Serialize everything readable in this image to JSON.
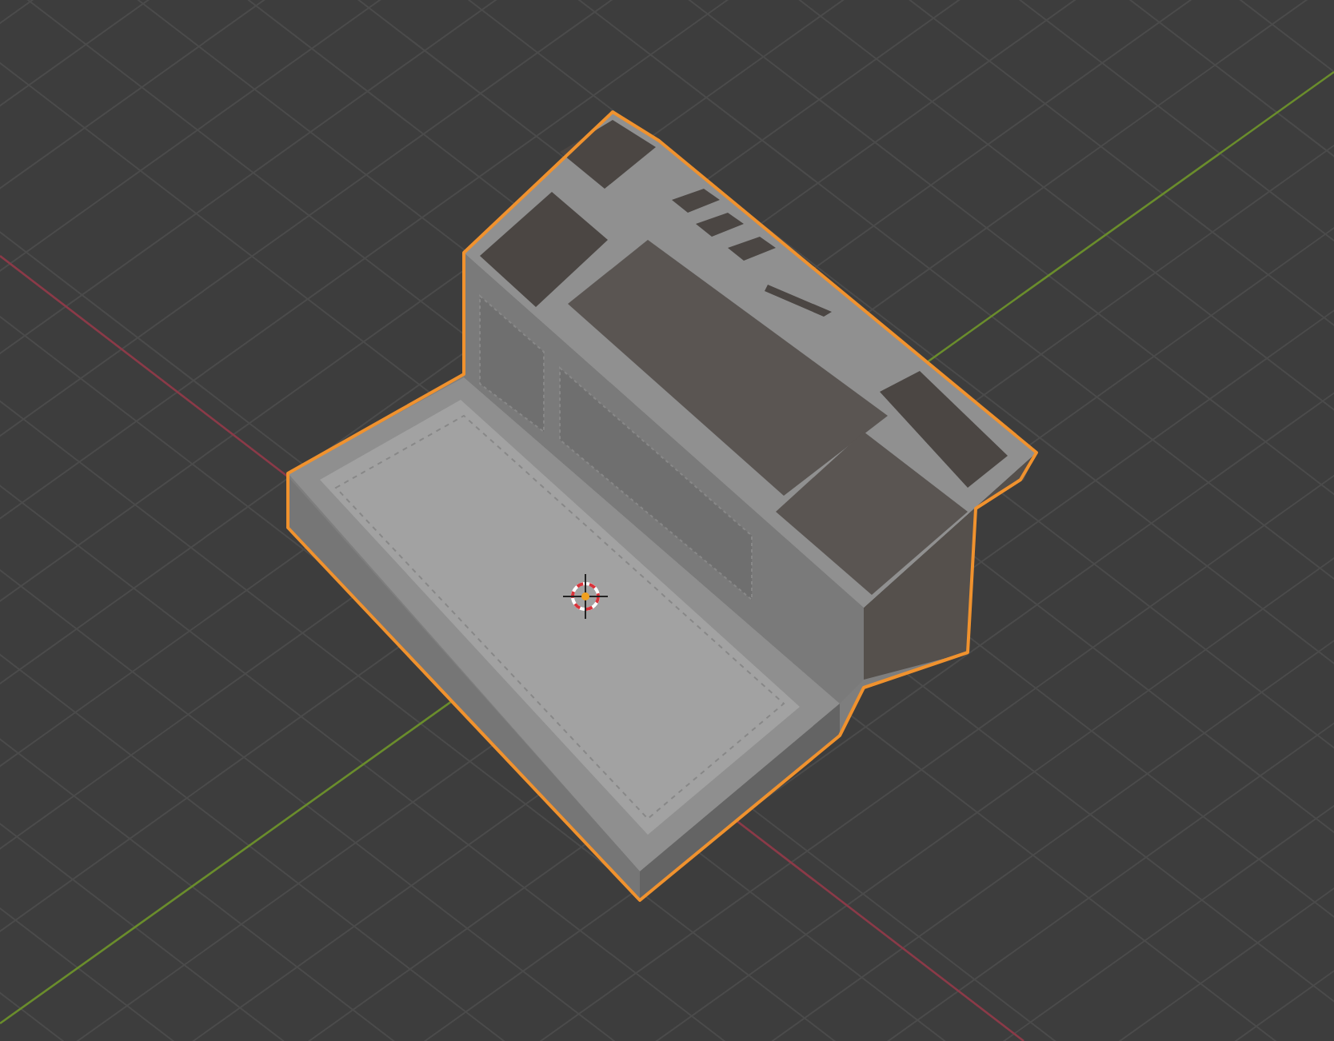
{
  "viewport": {
    "object_selected": true,
    "cursor_visible": true
  }
}
